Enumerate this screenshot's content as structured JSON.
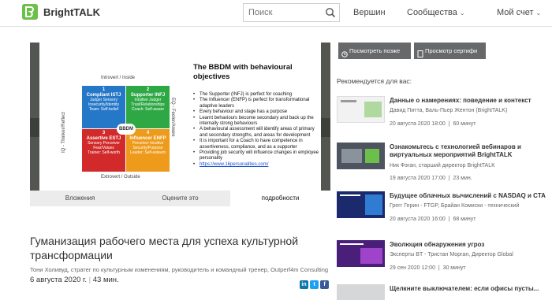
{
  "header": {
    "brand": "BrightTALK",
    "search_placeholder": "Поиск",
    "nav": [
      "Вершин",
      "Сообщества",
      "Мой счет"
    ]
  },
  "slide": {
    "title": "The BBDM with behavioural objectives",
    "top_label": "Introvert / Inside",
    "bottom_label": "Extrovert / Outside",
    "left_label": "IQ - Thinker/Reflect",
    "right_label": "EQ - Feeler/Aware",
    "center_label": "BBDM",
    "quadrants": [
      {
        "num": "1",
        "title": "Compliant ISTJ",
        "sub": "Judger\nSensory",
        "trait": "Insecurity/Identity",
        "type": "Team: Self-belief"
      },
      {
        "num": "2",
        "title": "Supporter INFJ",
        "sub": "Intuitive\nJudger",
        "trait": "Trust/Relationships",
        "type": "Coach: Self-aware"
      },
      {
        "num": "3",
        "title": "Assertive ESTJ",
        "sub": "Sensory\nPerceiver",
        "trait": "Fear/Values",
        "type": "Trainer: Self-worth"
      },
      {
        "num": "4",
        "title": "Influencer ENFP",
        "sub": "Perceiver\nIntuitive",
        "trait": "Security/Purpose",
        "type": "Leader: Self-esteem"
      }
    ],
    "bullets": [
      "The Supporter (INFJ) is perfect for coaching",
      "The Influencer (ENFP) is perfect for transformational adaptive leaders",
      "Every behaviour and stage has a purpose",
      "Learnt behaviours become secondary and back up the internally strong behaviours",
      "A behavioural assessment will identify areas of primary and secondary strengths, and areas for development",
      "It is important for a Coach to have competence in assertiveness, compliance, and as a supporter",
      "Providing job security will influence changes in employee personality"
    ],
    "link": "https://www.16personalities.com/"
  },
  "tabs": [
    "Вложения",
    "Оцените это",
    "подробности"
  ],
  "talk": {
    "title": "Гуманизация рабочего места для успеха культурной трансформации",
    "author": "Тони Холивуд, стратег по культурным изменениям, руководитель и командный тренер, Outperf4m Consulting",
    "date": "6 августа 2020 г.",
    "duration": "43 мин."
  },
  "buttons": {
    "watch_later": "Посмотреть позже",
    "view_cert": "Просмотр сертифи"
  },
  "recommended": {
    "heading": "Рекомендуется для вас:",
    "items": [
      {
        "title": "Данные о намерениях: поведение и контекст",
        "speaker": "Давид Питта, Валь-Пьер Жентон (BrightTALK)",
        "date": "20 августа 2020 18:00",
        "duration": "60 минут"
      },
      {
        "title": "Ознакомьтесь с технологией вебинаров и виртуальных мероприятий BrightTALK",
        "speaker": "Ник Фэган, старший директор BrightTALK",
        "date": "19 августа 2020 17:00",
        "duration": "23 мин."
      },
      {
        "title": "Будущее облачных вычислений с NASDAQ и CTA",
        "speaker": "Грегг Герин - FTGP, Брайан Комиски - технический",
        "date": "20 августа 2020 16:00",
        "duration": "68 минут"
      },
      {
        "title": "Эволюция обнаружения угроз",
        "speaker": "Эксперты BT - Тристан Морган, Директор Global",
        "date": "29 сен 2020 12:00",
        "duration": "30 минут"
      },
      {
        "title": "Щелкните выключателем: если офисы пусты...",
        "speaker": "",
        "date": "",
        "duration": ""
      }
    ]
  },
  "colors": {
    "brand_green": "#6cc04a",
    "q_blue": "#2577c8",
    "q_green": "#2da844",
    "q_red": "#d22a2a",
    "q_orange": "#ee9a1a"
  }
}
